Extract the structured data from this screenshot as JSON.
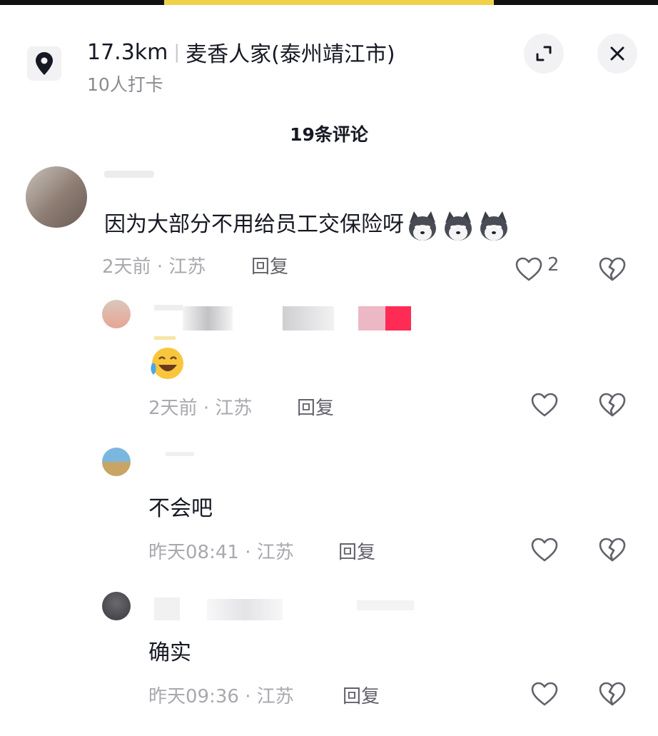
{
  "location": {
    "distance": "17.3km",
    "name": "麦香人家(泰州靖江市)",
    "checkins": "10人打卡"
  },
  "comment_count": "19条评论",
  "comments": [
    {
      "text": "因为大部分不用给员工交保险呀",
      "emoji_count": 3,
      "time": "2天前",
      "region": "江苏",
      "reply_label": "回复",
      "likes": "2"
    }
  ],
  "replies": [
    {
      "text": "",
      "emoji": "laughing-crying-emoji",
      "time": "2天前",
      "region": "江苏",
      "reply_label": "回复"
    },
    {
      "text": "不会吧",
      "time": "昨天08:41",
      "region": "江苏",
      "reply_label": "回复"
    },
    {
      "text": "确实",
      "time": "昨天09:36",
      "region": "江苏",
      "reply_label": "回复"
    }
  ],
  "meta_separator": "·",
  "icons": {
    "location": "map-pin-icon",
    "expand": "expand-icon",
    "close": "close-icon",
    "like": "heart-icon",
    "dislike": "broken-heart-icon"
  },
  "colors": {
    "text": "#161823",
    "meta": "#a8a9ae",
    "accent_pink": "#fe2c55"
  }
}
